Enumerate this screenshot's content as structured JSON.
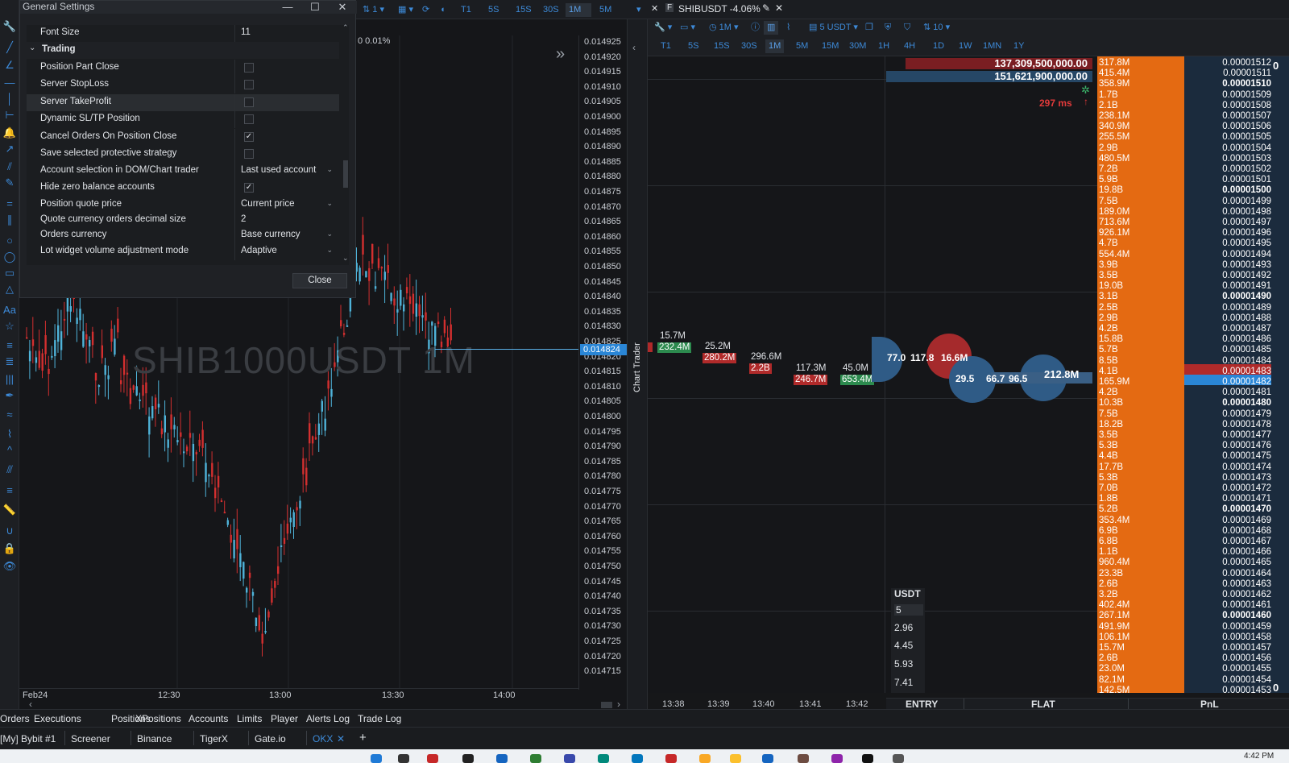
{
  "dialog": {
    "title": "General Settings",
    "minimize": "—",
    "maximize": "☐",
    "close": "✕",
    "close_button": "Close",
    "rows": [
      {
        "label": "Font Size",
        "value": "11",
        "kind": "text"
      },
      {
        "label": "Trading",
        "value": "",
        "kind": "section"
      },
      {
        "label": "Position Part Close",
        "value": "",
        "kind": "check"
      },
      {
        "label": "Server StopLoss",
        "value": "",
        "kind": "check"
      },
      {
        "label": "Server TakeProfit",
        "value": "",
        "kind": "check"
      },
      {
        "label": "Dynamic SL/TP Position",
        "value": "",
        "kind": "check"
      },
      {
        "label": "Cancel Orders On Position Close",
        "value": "✓",
        "kind": "check"
      },
      {
        "label": "Save selected protective strategy",
        "value": "",
        "kind": "check"
      },
      {
        "label": "Account selection in DOM/Chart trader",
        "value": "Last used account",
        "kind": "dropdown"
      },
      {
        "label": "Hide zero balance accounts",
        "value": "✓",
        "kind": "check"
      },
      {
        "label": "Position quote price",
        "value": "Current price",
        "kind": "dropdown"
      },
      {
        "label": "Quote currency orders decimal size",
        "value": "2",
        "kind": "text"
      },
      {
        "label": "Orders currency",
        "value": "Base currency",
        "kind": "dropdown"
      },
      {
        "label": "Lot widget volume adjustment mode",
        "value": "Adaptive",
        "kind": "dropdown"
      }
    ]
  },
  "left_chart": {
    "toolbar_timeframes": [
      "T1",
      "5S",
      "15S",
      "30S",
      "1M",
      "5M"
    ],
    "active_timeframe": "1M",
    "watermark": "SHIB1000USDT 1M",
    "pct_label": "0  0.01%",
    "current_price": "0.014824",
    "price_ticks": [
      "0.014925",
      "0.014920",
      "0.014915",
      "0.014910",
      "0.014905",
      "0.014900",
      "0.014895",
      "0.014890",
      "0.014885",
      "0.014880",
      "0.014875",
      "0.014870",
      "0.014865",
      "0.014860",
      "0.014855",
      "0.014850",
      "0.014845",
      "0.014840",
      "0.014835",
      "0.014830",
      "0.014825",
      "0.014820",
      "0.014815",
      "0.014810",
      "0.014805",
      "0.014800",
      "0.014795",
      "0.014790",
      "0.014785",
      "0.014780",
      "0.014775",
      "0.014770",
      "0.014765",
      "0.014760",
      "0.014755",
      "0.014750",
      "0.014745",
      "0.014740",
      "0.014735",
      "0.014730",
      "0.014725",
      "0.014720",
      "0.014715"
    ],
    "time_ticks": [
      "Feb24",
      "12:30",
      "13:00",
      "13:30",
      "14:00"
    ]
  },
  "chart_trader_label": "Chart Trader",
  "right_panel": {
    "symbol_tab": "SHIBUSDT -4.06%",
    "toolbar": {
      "interval": "1M",
      "volume": "5 USDT",
      "leverage": "10"
    },
    "timeframes": [
      "T1",
      "5S",
      "15S",
      "30S",
      "1M",
      "5M",
      "15M",
      "30M",
      "1H",
      "4H",
      "1D",
      "1W",
      "1MN",
      "1Y"
    ],
    "active_timeframe": "1M",
    "time_ticks": [
      "13:38",
      "13:39",
      "13:40",
      "13:41",
      "13:42"
    ],
    "ask_big_volume": "137,309,500,000.00",
    "bid_big_volume": "151,621,900,000.00",
    "latency": "297 ms",
    "cluster_labels": {
      "c1_top": "15.7M",
      "c1_bot": "232.4M",
      "c2_top": "25.2M",
      "c2_bot": "280.2M",
      "c3_top": "296.6M",
      "c3_bot": "2.2B",
      "c4_top": "117.3M",
      "c4_bot": "246.7M",
      "c5_top": "45.0M",
      "c5_bot": "653.4M"
    },
    "bubble_labels": {
      "b1": "77.0",
      "b2": "117.8",
      "b3": "16.6M",
      "b4": "29.5",
      "b5": "66.7",
      "b6": "96.5",
      "b7": "212.8M"
    },
    "usdt": {
      "title": "USDT",
      "values": [
        "5",
        "2.96",
        "4.45",
        "5.93",
        "7.41"
      ]
    },
    "entry_bar": {
      "entry": "ENTRY",
      "flat": "FLAT",
      "pnl": "PnL"
    },
    "position_top": "0",
    "position_bottom": "0",
    "volumes": [
      "317.8M",
      "415.4M",
      "358.9M",
      "1.7B",
      "2.1B",
      "238.1M",
      "340.9M",
      "255.5M",
      "2.9B",
      "480.5M",
      "7.2B",
      "5.9B",
      "19.8B",
      "7.5B",
      "189.0M",
      "713.6M",
      "926.1M",
      "4.7B",
      "554.4M",
      "3.9B",
      "3.5B",
      "19.0B",
      "3.1B",
      "2.5B",
      "2.9B",
      "4.2B",
      "15.8B",
      "5.7B",
      "8.5B",
      "4.1B",
      "165.9M",
      "4.2B",
      "10.3B",
      "7.5B",
      "18.2B",
      "3.5B",
      "5.3B",
      "4.4B",
      "17.7B",
      "5.3B",
      "7.0B",
      "1.8B",
      "5.2B",
      "353.4M",
      "6.9B",
      "6.8B",
      "1.1B",
      "960.4M",
      "23.3B",
      "2.6B",
      "3.2B",
      "402.4M",
      "267.1M",
      "491.9M",
      "106.1M",
      "15.7M",
      "2.6B",
      "23.0M",
      "82.1M",
      "142.5M"
    ],
    "prices": [
      "0.00001512",
      "0.00001511",
      "0.00001510",
      "0.00001509",
      "0.00001508",
      "0.00001507",
      "0.00001506",
      "0.00001505",
      "0.00001504",
      "0.00001503",
      "0.00001502",
      "0.00001501",
      "0.00001500",
      "0.00001499",
      "0.00001498",
      "0.00001497",
      "0.00001496",
      "0.00001495",
      "0.00001494",
      "0.00001493",
      "0.00001492",
      "0.00001491",
      "0.00001490",
      "0.00001489",
      "0.00001488",
      "0.00001487",
      "0.00001486",
      "0.00001485",
      "0.00001484",
      "0.00001483",
      "0.00001482",
      "0.00001481",
      "0.00001480",
      "0.00001479",
      "0.00001478",
      "0.00001477",
      "0.00001476",
      "0.00001475",
      "0.00001474",
      "0.00001473",
      "0.00001472",
      "0.00001471",
      "0.00001470",
      "0.00001469",
      "0.00001468",
      "0.00001467",
      "0.00001466",
      "0.00001465",
      "0.00001464",
      "0.00001463",
      "0.00001462",
      "0.00001461",
      "0.00001460",
      "0.00001459",
      "0.00001458",
      "0.00001457",
      "0.00001456",
      "0.00001455",
      "0.00001454",
      "0.00001453"
    ]
  },
  "bottom_tabs": [
    "Orders",
    "Executions",
    "Positions",
    "XPositions",
    "Accounts",
    "Limits",
    "Player",
    "Alerts Log",
    "Trade Log"
  ],
  "connection_tabs": [
    "[My] Bybit #1",
    "Screener",
    "Binance",
    "TigerX",
    "Gate.io",
    "OKX"
  ],
  "active_connection": "OKX",
  "clock": "4:42 PM"
}
